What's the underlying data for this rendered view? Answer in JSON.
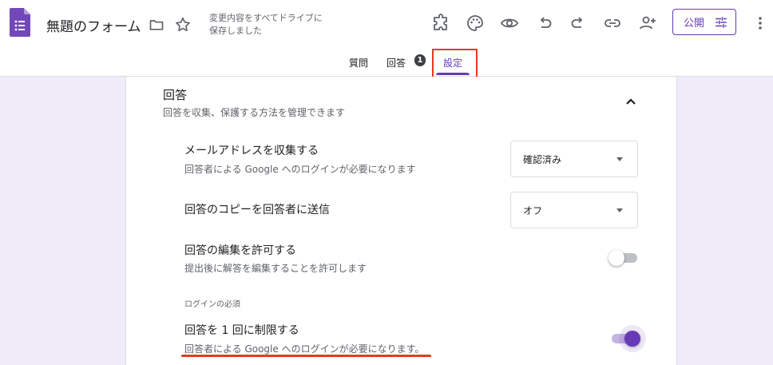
{
  "header": {
    "title": "無題のフォーム",
    "save_status_line1": "変更内容をすべてドライブに",
    "save_status_line2": "保存しました",
    "publish_label": "公開",
    "icons": [
      "forms-logo-icon",
      "folder-icon",
      "star-icon",
      "puzzle-addon-icon",
      "palette-icon",
      "preview-eye-icon",
      "undo-icon",
      "redo-icon",
      "link-icon",
      "add-collaborator-icon",
      "sliders-icon",
      "more-vert-icon"
    ]
  },
  "tabs": {
    "questions": "質問",
    "responses": "回答",
    "responses_badge": "1",
    "settings": "設定"
  },
  "section": {
    "title": "回答",
    "subtitle": "回答を収集、保護する方法を管理できます"
  },
  "settings": {
    "collect_email": {
      "title": "メールアドレスを収集する",
      "subtitle": "回答者による Google へのログインが必要になります",
      "value": "確認済み"
    },
    "send_copy": {
      "title": "回答のコピーを回答者に送信",
      "value": "オフ"
    },
    "allow_edit": {
      "title": "回答の編集を許可する",
      "subtitle": "提出後に解答を編集することを許可します",
      "enabled": false
    },
    "login_group_label": "ログインの必須",
    "limit_one": {
      "title": "回答を 1 回に制限する",
      "subtitle": "回答者による Google へのログインが必要になります。",
      "enabled": true
    }
  },
  "colors": {
    "accent": "#673ab7",
    "highlight": "#e53b1c",
    "background": "#f0ebf8"
  }
}
